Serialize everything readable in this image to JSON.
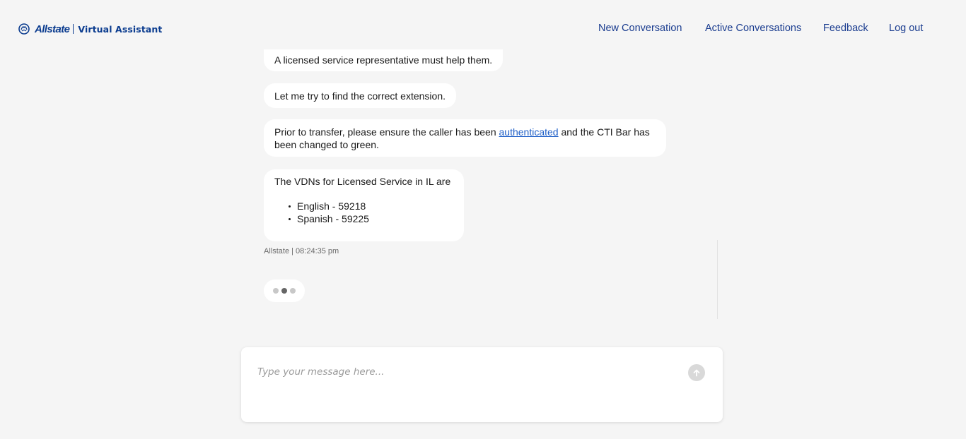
{
  "header": {
    "brand": "Allstate",
    "product": "Virtual Assistant",
    "nav": {
      "new_conversation": "New Conversation",
      "active_conversations": "Active Conversations",
      "feedback": "Feedback",
      "log_out": "Log out"
    }
  },
  "messages": [
    {
      "text": "A licensed service representative must help them."
    },
    {
      "text": "Let me try to find the correct extension."
    },
    {
      "text_before_link": "Prior to transfer, please ensure the caller has been ",
      "link": "authenticated",
      "text_after_link": " and the CTI Bar has been changed to green."
    },
    {
      "intro": "The VDNs for Licensed Service in IL are",
      "items": [
        "English - 59218",
        "Spanish - 59225"
      ]
    }
  ],
  "message_meta": "Allstate | 08:24:35 pm",
  "composer": {
    "placeholder": "Type your message here..."
  },
  "icons": {
    "send": "arrow-up-icon",
    "brand": "allstate-hands-icon"
  },
  "colors": {
    "brand_blue": "#0b3c8f",
    "nav_text": "#1a3c8f",
    "link": "#1f5fc7",
    "background": "#f5f5f5",
    "bubble": "#ffffff"
  }
}
